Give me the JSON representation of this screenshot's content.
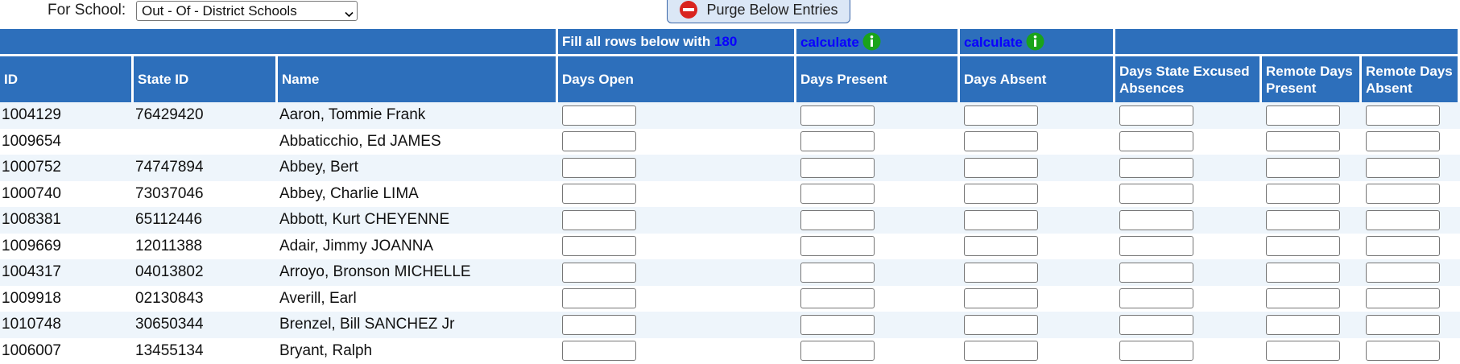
{
  "school_filter": {
    "label": "For School:",
    "selected": "Out - Of - District Schools"
  },
  "purge_button": {
    "label": "Purge Below Entries"
  },
  "fill_row": {
    "text": "Fill all rows below with",
    "value": "180"
  },
  "calc": {
    "present_label": "calculate",
    "absent_label": "calculate"
  },
  "columns": [
    "ID",
    "State ID",
    "Name",
    "Days Open",
    "Days Present",
    "Days Absent",
    "Days State Excused Absences",
    "Remote Days Present",
    "Remote Days Absent"
  ],
  "rows": [
    {
      "id": "1004129",
      "state_id": "76429420",
      "name": "Aaron, Tommie Frank"
    },
    {
      "id": "1009654",
      "state_id": "",
      "name": "Abbaticchio, Ed JAMES"
    },
    {
      "id": "1000752",
      "state_id": "74747894",
      "name": "Abbey, Bert"
    },
    {
      "id": "1000740",
      "state_id": "73037046",
      "name": "Abbey, Charlie LIMA"
    },
    {
      "id": "1008381",
      "state_id": "65112446",
      "name": "Abbott, Kurt CHEYENNE"
    },
    {
      "id": "1009669",
      "state_id": "12011388",
      "name": "Adair, Jimmy JOANNA"
    },
    {
      "id": "1004317",
      "state_id": "04013802",
      "name": "Arroyo, Bronson MICHELLE"
    },
    {
      "id": "1009918",
      "state_id": "02130843",
      "name": "Averill, Earl"
    },
    {
      "id": "1010748",
      "state_id": "30650344",
      "name": "Brenzel, Bill SANCHEZ Jr"
    },
    {
      "id": "1006007",
      "state_id": "13455134",
      "name": "Bryant, Ralph"
    }
  ],
  "colors": {
    "header_bg": "#2d6fbb",
    "row_alt_bg": "#eef5fb",
    "link": "#0a00ff",
    "info_icon": "#1aa31a",
    "purge_icon": "#d9241f"
  }
}
